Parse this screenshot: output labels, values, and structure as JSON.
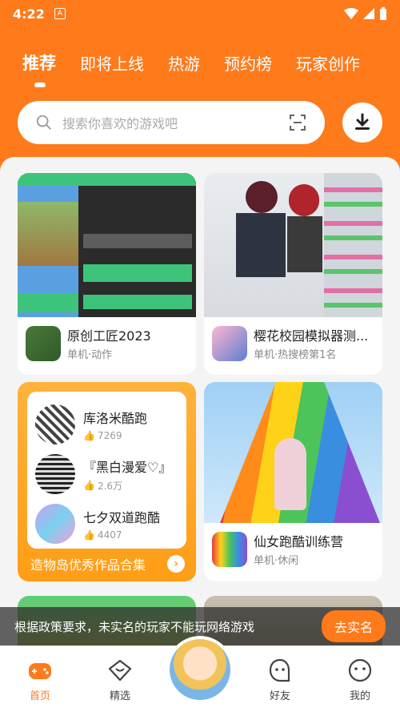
{
  "status": {
    "time": "4:22",
    "notif": "A"
  },
  "tabs": [
    "推荐",
    "即将上线",
    "热游",
    "预约榜",
    "玩家创作"
  ],
  "search": {
    "placeholder": "搜索你喜欢的游戏吧"
  },
  "games": [
    {
      "name": "原创工匠2023",
      "sub": "单机·动作"
    },
    {
      "name": "樱花校园模拟器测...",
      "sub": "单机·热搜榜第1名"
    },
    {
      "name": "仙女跑酷训练营",
      "sub": "单机·休闲"
    }
  ],
  "collection": {
    "items": [
      {
        "title": "库洛米酷跑",
        "likes": "7269"
      },
      {
        "title": "『黑白漫爱♡』",
        "likes": "2.6万"
      },
      {
        "title": "七夕双道跑酷",
        "likes": "4407"
      }
    ],
    "footer": "造物岛优秀作品合集"
  },
  "banner": {
    "text": "根据政策要求，未实名的玩家不能玩网络游戏",
    "button": "去实名"
  },
  "nav": [
    "首页",
    "精选",
    "好友",
    "我的"
  ],
  "colors": {
    "accent": "#ff7a1a"
  }
}
